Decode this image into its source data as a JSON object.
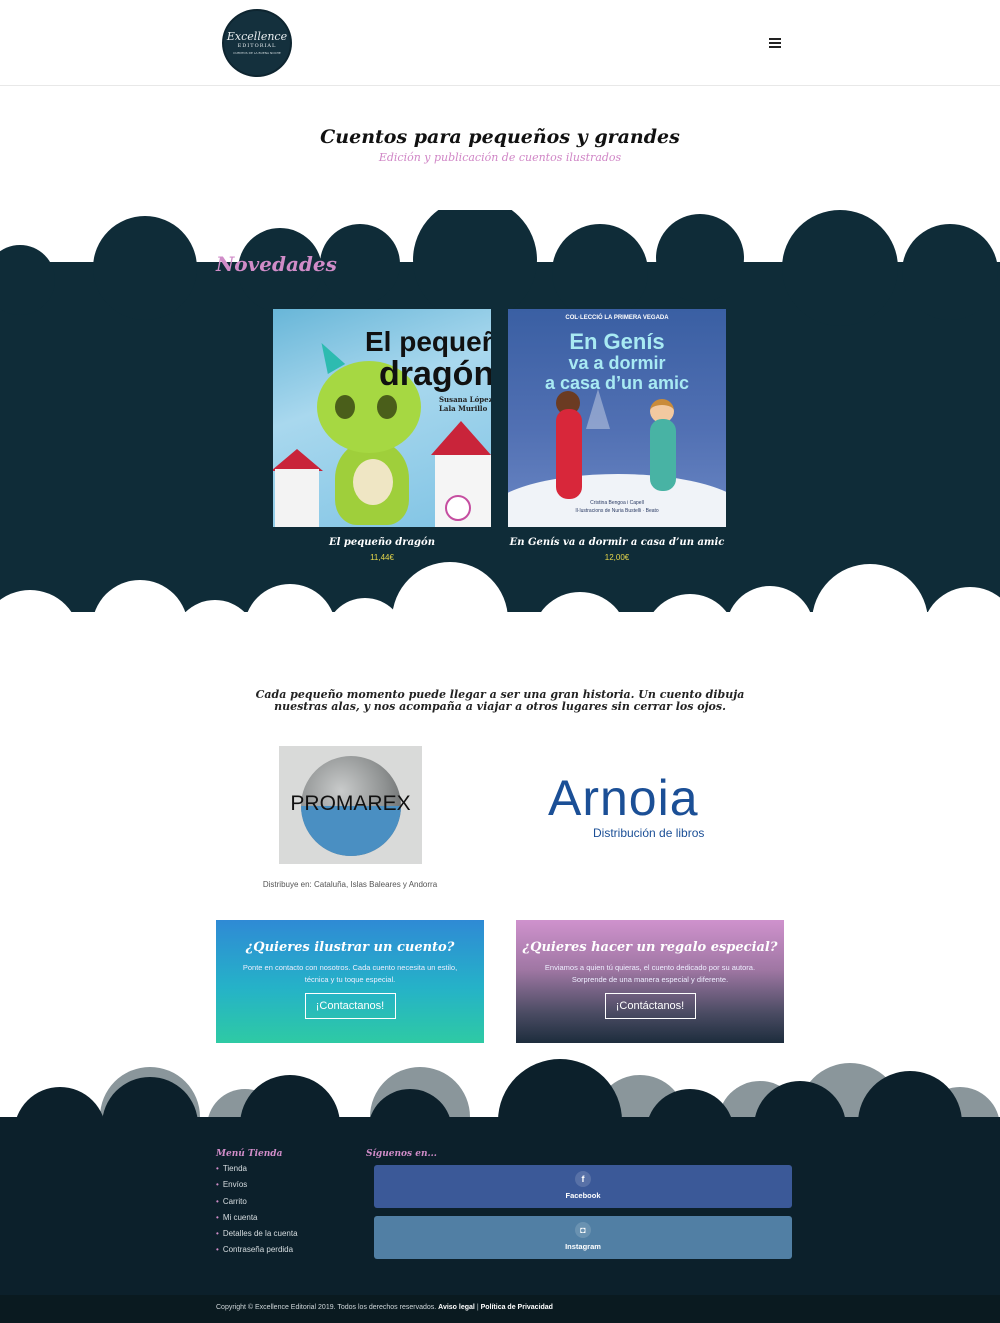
{
  "logo": {
    "line1": "Excellence",
    "line2": "EDITORIAL",
    "line3": "CUENTOS DE LA BUENA NOCHE"
  },
  "colors": {
    "dark_navy": "#0f2c38",
    "footer_navy": "#0c202b",
    "pink_accent": "#d08cc8",
    "price_yellow": "#e6d64a"
  },
  "header": {
    "menu_icon": "hamburger-menu-icon"
  },
  "hero": {
    "title": "Cuentos para pequeños y grandes",
    "subtitle": "Edición y publicación de cuentos ilustrados"
  },
  "novedades": {
    "title": "Novedades",
    "products": [
      {
        "name": "El pequeño dragón",
        "price": "11,44€",
        "cover": {
          "title_line1": "El pequeño",
          "title_line2": "dragón",
          "authors": "Susana López\nLala Murillo"
        }
      },
      {
        "name": "En Genís va a dormir a casa d’un amic",
        "price": "12,00€",
        "cover": {
          "collection": "COL·LECCIÓ LA PRIMERA VEGADA",
          "title_line1": "En Genís",
          "title_line2": "va a dormir",
          "title_line3": "a casa d’un amic",
          "authors": "Cristina Bengoa i Capell\nIl·lustracions de Nuria Bustelli · Beato"
        }
      }
    ]
  },
  "quote": "Cada pequeño momento puede llegar a ser una gran historia. Un cuento dibuja nuestras alas, y nos acompaña a viajar a otros lugares sin cerrar los ojos.",
  "distributors": {
    "promarex": {
      "logo_text": "PROMAREX",
      "caption": "Distribuye en: Cataluña, Islas Baleares y Andorra"
    },
    "arnoia": {
      "logo_text": "Arnoia",
      "subtitle": "Distribución de libros"
    }
  },
  "cta": [
    {
      "title": "¿Quieres ilustrar un cuento?",
      "text": "Ponte en contacto con nosotros. Cada cuento necesita un estilo, técnica y tu toque especial.",
      "button": "¡Contactanos!"
    },
    {
      "title": "¿Quieres hacer un regalo especial?",
      "text": "Enviamos a quien tú quieras, el cuento dedicado por su autora. Sorprende de una manera especial y diferente.",
      "button": "¡Contáctanos!"
    }
  ],
  "footer": {
    "menu_title": "Menú Tienda",
    "menu_items": [
      "Tienda",
      "Envíos",
      "Carrito",
      "Mi cuenta",
      "Detalles de la cuenta",
      "Contraseña perdida"
    ],
    "follow_title": "Síguenos en...",
    "social": [
      {
        "label": "Facebook",
        "icon_glyph": "f",
        "icon": "facebook-icon"
      },
      {
        "label": "Instagram",
        "icon_glyph": "◘",
        "icon": "instagram-icon"
      }
    ],
    "copyright": "Copyright © Excellence Editorial 2019. Todos los derechos reservados.",
    "legal_link": "Aviso legal",
    "separator": "|",
    "privacy_link": "Política de Privacidad"
  }
}
